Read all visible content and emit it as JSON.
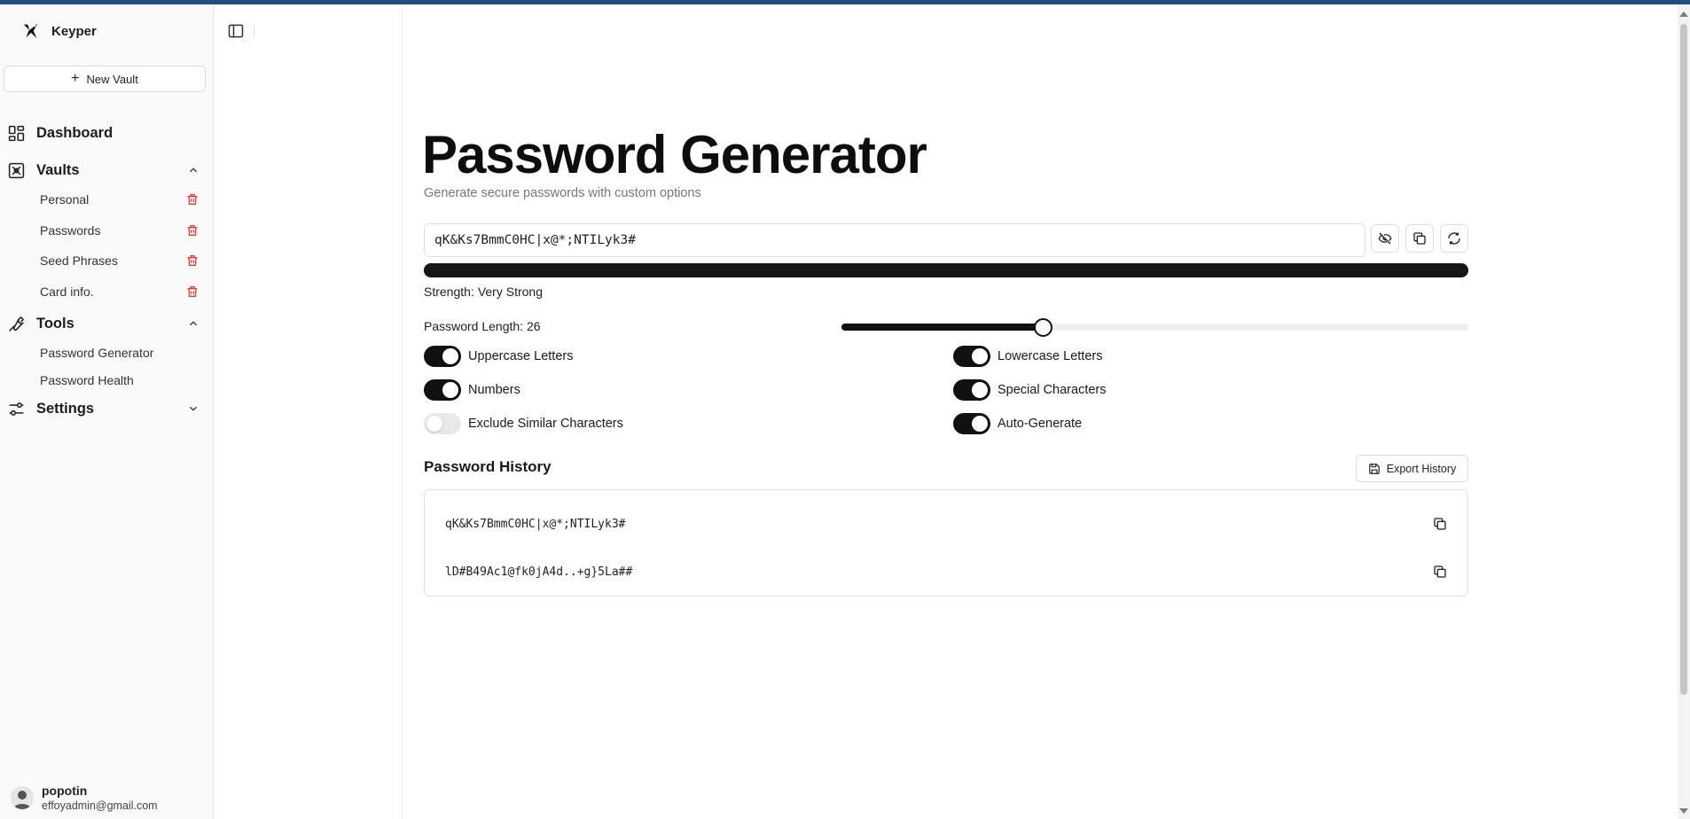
{
  "app": {
    "name": "Keyper",
    "accent_color": "#1f4f82"
  },
  "sidebar": {
    "new_vault_label": "New Vault",
    "dashboard_label": "Dashboard",
    "vaults": {
      "label": "Vaults",
      "expanded": true,
      "items": [
        {
          "label": "Personal"
        },
        {
          "label": "Passwords"
        },
        {
          "label": "Seed Phrases"
        },
        {
          "label": "Card info."
        }
      ]
    },
    "tools": {
      "label": "Tools",
      "expanded": true,
      "items": [
        {
          "label": "Password Generator"
        },
        {
          "label": "Password Health"
        }
      ]
    },
    "settings": {
      "label": "Settings",
      "expanded": false
    },
    "user": {
      "name": "popotin",
      "email": "effoyadmin@gmail.com"
    }
  },
  "main": {
    "title": "Password Generator",
    "subtitle": "Generate secure passwords with custom options",
    "password_value": "qK&Ks7BmmC0HC|x@*;NTILyk3#",
    "strength_label": "Strength:",
    "strength_value": "Very Strong",
    "strength_fraction": 1.0,
    "length_label": "Password Length:",
    "length_value": "26",
    "length_slider": {
      "min": 8,
      "max": 64,
      "value": 26
    },
    "options": {
      "uppercase": {
        "label": "Uppercase Letters",
        "on": true
      },
      "lowercase": {
        "label": "Lowercase Letters",
        "on": true
      },
      "numbers": {
        "label": "Numbers",
        "on": true
      },
      "special": {
        "label": "Special Characters",
        "on": true
      },
      "exclude_similar": {
        "label": "Exclude Similar Characters",
        "on": false
      },
      "auto_generate": {
        "label": "Auto-Generate",
        "on": true
      }
    },
    "history": {
      "title": "Password History",
      "export_label": "Export History",
      "items": [
        {
          "value": "qK&Ks7BmmC0HC|x@*;NTILyk3#"
        },
        {
          "value": "lD#B49Ac1@fk0jA4d..+g}5La##"
        }
      ]
    }
  }
}
